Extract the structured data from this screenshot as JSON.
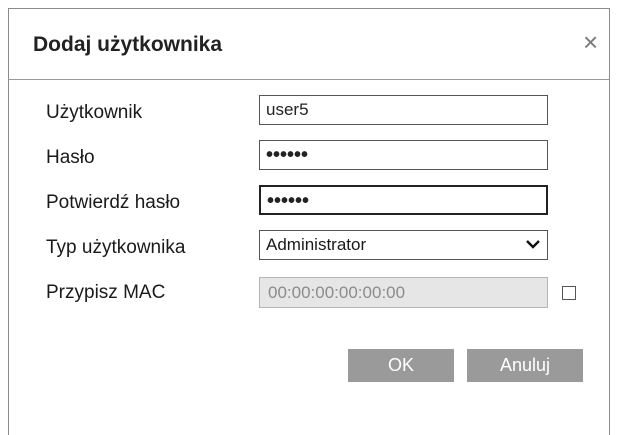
{
  "dialog": {
    "title": "Dodaj użytkownika",
    "close_symbol": "×"
  },
  "form": {
    "username_label": "Użytkownik",
    "username_value": "user5",
    "password_label": "Hasło",
    "password_value": "••••••",
    "confirm_label": "Potwierdź hasło",
    "confirm_value": "••••••",
    "user_type_label": "Typ użytkownika",
    "user_type_value": "Administrator",
    "mac_label": "Przypisz MAC",
    "mac_value": "00:00:00:00:00:00",
    "mac_checkbox_checked": false
  },
  "buttons": {
    "ok": "OK",
    "cancel": "Anuluj"
  },
  "icons": {
    "close": "close-icon",
    "dropdown": "chevron-down-icon"
  }
}
